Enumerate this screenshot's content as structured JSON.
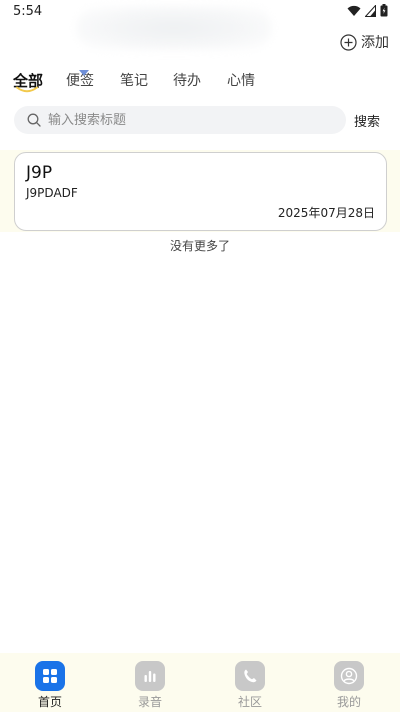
{
  "status_bar": {
    "time": "5:54"
  },
  "header": {
    "add_label": "添加"
  },
  "tabs": [
    {
      "label": "全部",
      "active": true
    },
    {
      "label": "便签",
      "active": false
    },
    {
      "label": "笔记",
      "active": false
    },
    {
      "label": "待办",
      "active": false
    },
    {
      "label": "心情",
      "active": false
    }
  ],
  "search": {
    "placeholder": "输入搜索标题",
    "value": "",
    "button_label": "搜索"
  },
  "notes": [
    {
      "title": "J9P",
      "content": "J9PDADF",
      "date": "2025年07月28日"
    }
  ],
  "list_footer": "没有更多了",
  "bottom_nav": [
    {
      "label": "首页",
      "icon": "grid-icon",
      "active": true
    },
    {
      "label": "录音",
      "icon": "bar-chart-icon",
      "active": false
    },
    {
      "label": "社区",
      "icon": "phone-icon",
      "active": false
    },
    {
      "label": "我的",
      "icon": "person-icon",
      "active": false
    }
  ],
  "colors": {
    "accent": "#1a73e8",
    "inactive_icon": "#c8c8c8",
    "inactive_text": "#999999",
    "list_background": "#fdfcee",
    "nav_background": "#fdfcee",
    "search_background": "#f2f3f5"
  }
}
